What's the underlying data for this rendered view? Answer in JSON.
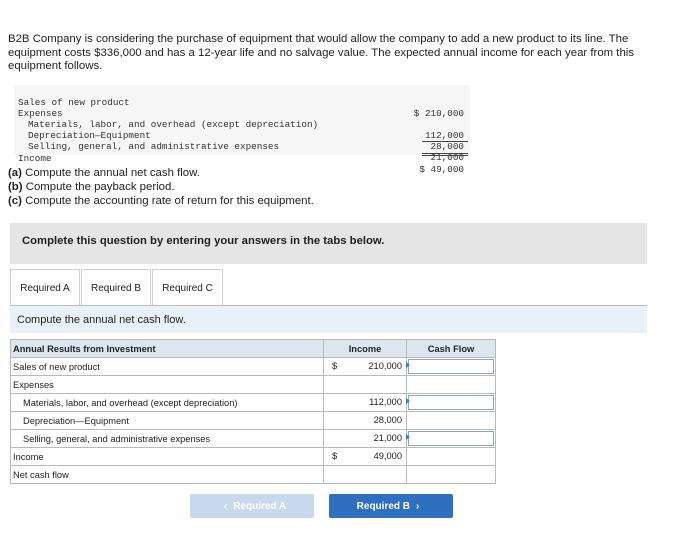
{
  "problem": {
    "text": "B2B Company is considering the purchase of equipment that would allow the company to add a new product to its line. The equipment costs $336,000 and has a 12-year life and no salvage value. The expected annual income for each year from this equipment follows."
  },
  "income_statement": {
    "rows": [
      {
        "label": "Sales of new product",
        "value": "$ 210,000",
        "indent": false
      },
      {
        "label": "Expenses",
        "value": "",
        "indent": false
      },
      {
        "label": "Materials, labor, and overhead (except depreciation)",
        "value": "112,000",
        "indent": true
      },
      {
        "label": "Depreciation—Equipment",
        "value": "28,000",
        "indent": true
      },
      {
        "label": "Selling, general, and administrative expenses",
        "value": "21,000",
        "indent": true
      },
      {
        "label": "Income",
        "value": "$ 49,000",
        "indent": false
      }
    ]
  },
  "requirements": {
    "a_tag": "(a)",
    "a_text": " Compute the annual net cash flow.",
    "b_tag": "(b)",
    "b_text": " Compute the payback period.",
    "c_tag": "(c)",
    "c_text": " Compute the accounting rate of return for this equipment."
  },
  "banner": {
    "text": "Complete this question by entering your answers in the tabs below."
  },
  "tabs": [
    "Required A",
    "Required B",
    "Required C"
  ],
  "instruction": "Compute the annual net cash flow.",
  "table": {
    "header": {
      "label": "Annual Results from Investment",
      "income": "Income",
      "cash_flow": "Cash Flow"
    },
    "rows": [
      {
        "label": "Sales of new product",
        "dollar": "$",
        "income": "210,000",
        "input": true
      },
      {
        "label": "Expenses",
        "dollar": "",
        "income": "",
        "input": false
      },
      {
        "label": "Materials, labor, and overhead (except depreciation)",
        "dollar": "",
        "income": "112,000",
        "input": true
      },
      {
        "label": "Depreciation—Equipment",
        "dollar": "",
        "income": "28,000",
        "input": false
      },
      {
        "label": "Selling, general, and administrative expenses",
        "dollar": "",
        "income": "21,000",
        "input": true
      },
      {
        "label": "Income",
        "dollar": "$",
        "income": "49,000",
        "input": false
      },
      {
        "label": "Net cash flow",
        "dollar": "",
        "income": "",
        "input": false
      }
    ]
  },
  "buttons": {
    "prev": "Required A",
    "next": "Required B"
  },
  "colors": {
    "accent": "#2e6fbf",
    "accent_disabled": "#c8d9ee",
    "header_bg": "#dde6f0",
    "instruction_bg": "#e8f1f9"
  }
}
